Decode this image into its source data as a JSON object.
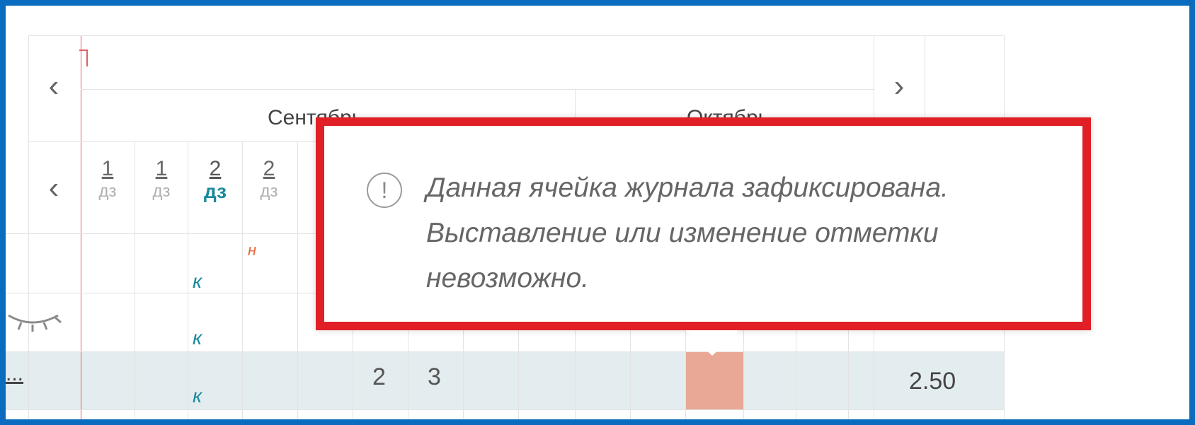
{
  "nav": {
    "prev_arrow": "‹",
    "next_arrow": "›"
  },
  "months": [
    {
      "label": "Сентябрь"
    },
    {
      "label": "Октябрь"
    }
  ],
  "lessons": [
    {
      "number": "1",
      "type": "дз"
    },
    {
      "number": "1",
      "type": "дз"
    },
    {
      "number": "2",
      "type": "дз"
    },
    {
      "number": "2",
      "type": "дз"
    }
  ],
  "marks": {
    "absence_k": "к",
    "absence_n": "н",
    "grade_1": "2",
    "grade_2": "3"
  },
  "student_row": {
    "name_truncated": "...",
    "average": "2.50"
  },
  "tooltip": {
    "icon": "!",
    "message": "Данная ячейка журнала зафиксирована. Выставление или изменение отметки невозможно."
  },
  "colors": {
    "frame": "#0a6cbf",
    "tooltip_border": "#e01f26",
    "accent_teal": "#1a8a9c",
    "absence_orange": "#e8663a",
    "highlight_row": "#e3ecee"
  }
}
